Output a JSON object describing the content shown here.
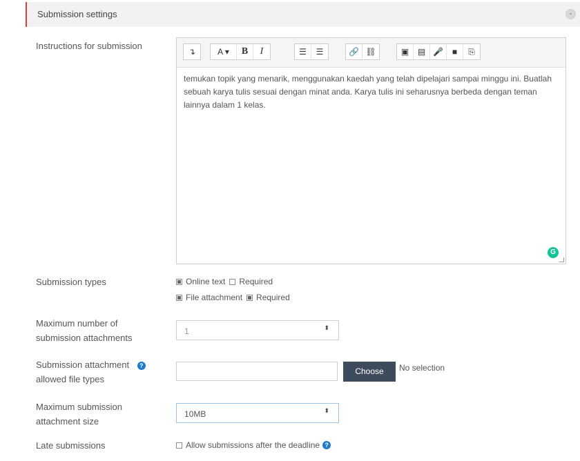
{
  "section": {
    "title": "Submission settings",
    "collapse_symbol": "-"
  },
  "instructions": {
    "label": "Instructions for submission",
    "toolbar": [
      [
        "↴"
      ],
      [
        "A ▾",
        "B",
        "I"
      ],
      [
        "☰",
        "☰"
      ],
      [
        "🔗",
        "⛓"
      ],
      [
        "▣",
        "▤",
        "🎤",
        "■",
        "⎘"
      ]
    ],
    "content": "temukan topik yang menarik, menggunakan kaedah yang telah dipelajari sampai minggu ini. Buatlah sebuah karya tulis sesuai dengan minat anda. Karya tulis ini seharusnya berbeda dengan teman lainnya dalam 1 kelas.",
    "grammarly_badge": "G"
  },
  "submission_types": {
    "label": "Submission types",
    "online_text": {
      "label": "Online text",
      "checked": true
    },
    "online_required": {
      "label": "Required",
      "checked": false
    },
    "file_attachment": {
      "label": "File attachment",
      "checked": true
    },
    "file_required": {
      "label": "Required",
      "checked": true
    }
  },
  "max_attachments": {
    "label_line1": "Maximum number of",
    "label_line2": "submission attachments",
    "value": "1",
    "arrow": "⬍"
  },
  "file_types": {
    "label_line1": "Submission attachment",
    "label_line2": "allowed file types",
    "help_symbol": "?",
    "input_value": "",
    "choose_label": "Choose",
    "no_selection": "No selection"
  },
  "max_size": {
    "label_line1": "Maximum submission",
    "label_line2": "attachment size",
    "value": "10MB",
    "arrow": "⬍"
  },
  "late": {
    "label": "Late submissions",
    "checkbox_label": "Allow submissions after the deadline",
    "checked": false,
    "help_symbol": "?"
  },
  "colors": {
    "accent_bar": "#e03a3a",
    "choose_button": "#3e4b5c",
    "help_icon": "#1f7ac9",
    "grammarly": "#15c39a"
  }
}
